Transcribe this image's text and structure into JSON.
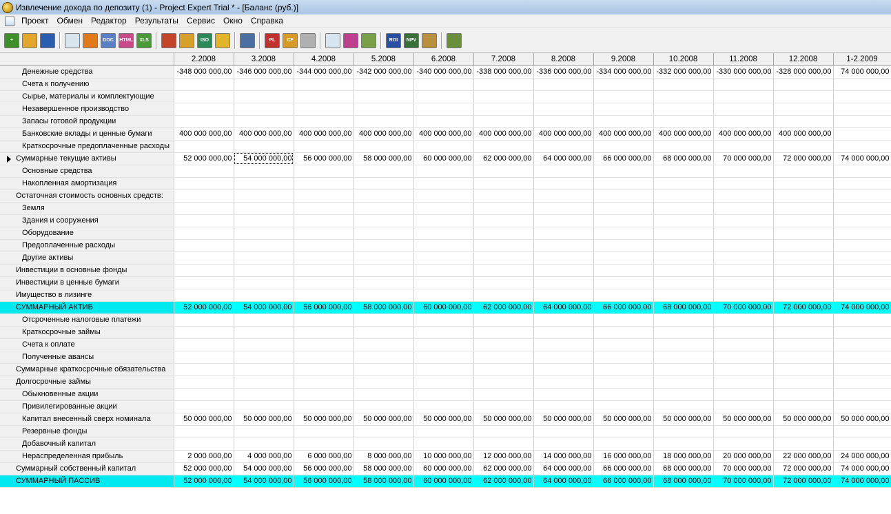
{
  "window": {
    "title": "Извлечение дохода по депозиту (1) - Project Expert Trial * - [Баланс (руб.)]"
  },
  "menu": [
    "Проект",
    "Обмен",
    "Редактор",
    "Результаты",
    "Сервис",
    "Окно",
    "Справка"
  ],
  "toolbar_icons": [
    {
      "name": "new-project-icon",
      "color": "#3f8f2a",
      "text": "+"
    },
    {
      "name": "open-project-icon",
      "color": "#e2a72a",
      "text": ""
    },
    {
      "name": "save-project-icon",
      "color": "#2a5fb0",
      "text": ""
    },
    {
      "sep": true
    },
    {
      "name": "preview-icon",
      "color": "#d8e4ee",
      "text": ""
    },
    {
      "name": "print-icon",
      "color": "#e07a1a",
      "text": ""
    },
    {
      "name": "doc-export-icon",
      "color": "#5b7fc7",
      "text": "DOC"
    },
    {
      "name": "html-export-icon",
      "color": "#c84a8a",
      "text": "HTML"
    },
    {
      "name": "xls-export-icon",
      "color": "#4a9a3a",
      "text": "XLS"
    },
    {
      "sep": true
    },
    {
      "name": "puzzle-icon",
      "color": "#c4452a",
      "text": ""
    },
    {
      "name": "edit-tool-icon",
      "color": "#d6a02a",
      "text": ""
    },
    {
      "name": "iso-icon",
      "color": "#2a8a5a",
      "text": "ISO"
    },
    {
      "name": "folder-data-icon",
      "color": "#e2b42a",
      "text": ""
    },
    {
      "sep": true
    },
    {
      "name": "print-report-icon",
      "color": "#4a6fa0",
      "text": ""
    },
    {
      "sep": true
    },
    {
      "name": "pl-report-icon",
      "color": "#c43030",
      "text": "PL"
    },
    {
      "name": "cf-report-icon",
      "color": "#d89a20",
      "text": "CF"
    },
    {
      "name": "balance-report-icon",
      "color": "#b0b0b0",
      "text": ""
    },
    {
      "sep": true
    },
    {
      "name": "zoom-icon",
      "color": "#d8e4ee",
      "text": ""
    },
    {
      "name": "user-icon",
      "color": "#c04090",
      "text": ""
    },
    {
      "name": "chart-icon",
      "color": "#7aa04a",
      "text": ""
    },
    {
      "sep": true
    },
    {
      "name": "roi-icon",
      "color": "#2a4fa0",
      "text": "ROI"
    },
    {
      "name": "npv-icon",
      "color": "#3a6f3a",
      "text": "NPV"
    },
    {
      "name": "clipboard-icon",
      "color": "#b89040",
      "text": ""
    },
    {
      "sep": true
    },
    {
      "name": "calculator-icon",
      "color": "#6a8f3a",
      "text": ""
    }
  ],
  "grid": {
    "columns": [
      "2.2008",
      "3.2008",
      "4.2008",
      "5.2008",
      "6.2008",
      "7.2008",
      "8.2008",
      "9.2008",
      "10.2008",
      "11.2008",
      "12.2008",
      "1-2.2009"
    ],
    "rows": [
      {
        "label": "Денежные средства",
        "indent": 2,
        "values": [
          "-348 000 000,00",
          "-346 000 000,00",
          "-344 000 000,00",
          "-342 000 000,00",
          "-340 000 000,00",
          "-338 000 000,00",
          "-336 000 000,00",
          "-334 000 000,00",
          "-332 000 000,00",
          "-330 000 000,00",
          "-328 000 000,00",
          "74 000 000,00"
        ]
      },
      {
        "label": "Счета к получению",
        "indent": 2,
        "values": []
      },
      {
        "label": "Сырье, материалы и комплектующие",
        "indent": 2,
        "values": []
      },
      {
        "label": "Незавершенное производство",
        "indent": 2,
        "values": []
      },
      {
        "label": "Запасы готовой продукции",
        "indent": 2,
        "values": []
      },
      {
        "label": "Банковские вклады и ценные бумаги",
        "indent": 2,
        "values": [
          "400 000 000,00",
          "400 000 000,00",
          "400 000 000,00",
          "400 000 000,00",
          "400 000 000,00",
          "400 000 000,00",
          "400 000 000,00",
          "400 000 000,00",
          "400 000 000,00",
          "400 000 000,00",
          "400 000 000,00",
          ""
        ]
      },
      {
        "label": "Краткосрочные предоплаченные расходы",
        "indent": 2,
        "values": []
      },
      {
        "label": "Суммарные текущие активы",
        "indent": 1,
        "current": true,
        "values": [
          "52 000 000,00",
          "54 000 000,00",
          "56 000 000,00",
          "58 000 000,00",
          "60 000 000,00",
          "62 000 000,00",
          "64 000 000,00",
          "66 000 000,00",
          "68 000 000,00",
          "70 000 000,00",
          "72 000 000,00",
          "74 000 000,00"
        ]
      },
      {
        "label": "Основные средства",
        "indent": 2,
        "values": []
      },
      {
        "label": "Накопленная амортизация",
        "indent": 2,
        "values": []
      },
      {
        "label": "Остаточная стоимость основных средств:",
        "indent": 1,
        "values": []
      },
      {
        "label": "Земля",
        "indent": 2,
        "values": []
      },
      {
        "label": "Здания и сооружения",
        "indent": 2,
        "values": []
      },
      {
        "label": "Оборудование",
        "indent": 2,
        "values": []
      },
      {
        "label": "Предоплаченные расходы",
        "indent": 2,
        "values": []
      },
      {
        "label": "Другие активы",
        "indent": 2,
        "values": []
      },
      {
        "label": "Инвестиции в основные фонды",
        "indent": 1,
        "values": []
      },
      {
        "label": "Инвестиции в ценные бумаги",
        "indent": 1,
        "values": []
      },
      {
        "label": "Имущество в лизинге",
        "indent": 1,
        "values": []
      },
      {
        "label": "СУММАРНЫЙ АКТИВ",
        "indent": 1,
        "highlight": true,
        "values": [
          "52 000 000,00",
          "54 000 000,00",
          "56 000 000,00",
          "58 000 000,00",
          "60 000 000,00",
          "62 000 000,00",
          "64 000 000,00",
          "66 000 000,00",
          "68 000 000,00",
          "70 000 000,00",
          "72 000 000,00",
          "74 000 000,00"
        ]
      },
      {
        "label": "Отсроченные налоговые платежи",
        "indent": 2,
        "values": []
      },
      {
        "label": "Краткосрочные займы",
        "indent": 2,
        "values": []
      },
      {
        "label": "Счета к оплате",
        "indent": 2,
        "values": []
      },
      {
        "label": "Полученные авансы",
        "indent": 2,
        "values": []
      },
      {
        "label": "Суммарные краткосрочные обязательства",
        "indent": 1,
        "values": []
      },
      {
        "label": "Долгосрочные займы",
        "indent": 1,
        "values": []
      },
      {
        "label": "Обыкновенные акции",
        "indent": 2,
        "values": []
      },
      {
        "label": "Привилегированные акции",
        "indent": 2,
        "values": []
      },
      {
        "label": "Капитал внесенный сверх номинала",
        "indent": 2,
        "values": [
          "50 000 000,00",
          "50 000 000,00",
          "50 000 000,00",
          "50 000 000,00",
          "50 000 000,00",
          "50 000 000,00",
          "50 000 000,00",
          "50 000 000,00",
          "50 000 000,00",
          "50 000 000,00",
          "50 000 000,00",
          "50 000 000,00"
        ]
      },
      {
        "label": "Резервные фонды",
        "indent": 2,
        "values": []
      },
      {
        "label": "Добавочный капитал",
        "indent": 2,
        "values": []
      },
      {
        "label": "Нераспределенная прибыль",
        "indent": 2,
        "values": [
          "2 000 000,00",
          "4 000 000,00",
          "6 000 000,00",
          "8 000 000,00",
          "10 000 000,00",
          "12 000 000,00",
          "14 000 000,00",
          "16 000 000,00",
          "18 000 000,00",
          "20 000 000,00",
          "22 000 000,00",
          "24 000 000,00"
        ]
      },
      {
        "label": "Суммарный собственный капитал",
        "indent": 1,
        "values": [
          "52 000 000,00",
          "54 000 000,00",
          "56 000 000,00",
          "58 000 000,00",
          "60 000 000,00",
          "62 000 000,00",
          "64 000 000,00",
          "66 000 000,00",
          "68 000 000,00",
          "70 000 000,00",
          "72 000 000,00",
          "74 000 000,00"
        ]
      },
      {
        "label": "СУММАРНЫЙ ПАССИВ",
        "indent": 1,
        "highlight": true,
        "values": [
          "52 000 000,00",
          "54 000 000,00",
          "56 000 000,00",
          "58 000 000,00",
          "60 000 000,00",
          "62 000 000,00",
          "64 000 000,00",
          "66 000 000,00",
          "68 000 000,00",
          "70 000 000,00",
          "72 000 000,00",
          "74 000 000,00"
        ]
      }
    ]
  },
  "colors": {
    "highlight_row": "#00ffff"
  }
}
